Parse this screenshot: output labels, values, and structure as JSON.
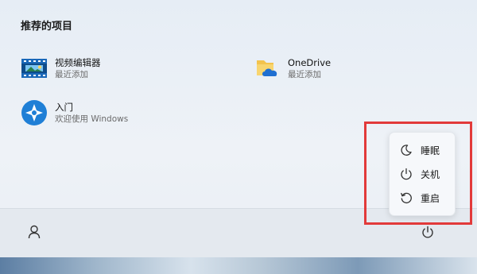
{
  "recommended": {
    "title": "推荐的项目",
    "items": [
      {
        "name": "视频编辑器",
        "subtitle": "最近添加",
        "icon": "video-editor-icon"
      },
      {
        "name": "OneDrive",
        "subtitle": "最近添加",
        "icon": "onedrive-icon"
      },
      {
        "name": "入门",
        "subtitle": "欢迎使用 Windows",
        "icon": "get-started-icon"
      }
    ]
  },
  "power_menu": {
    "items": [
      {
        "label": "睡眠",
        "icon": "sleep-icon"
      },
      {
        "label": "关机",
        "icon": "power-icon"
      },
      {
        "label": "重启",
        "icon": "restart-icon"
      }
    ]
  },
  "footer": {
    "user_icon": "user-icon",
    "power_icon": "power-icon"
  },
  "colors": {
    "highlight": "#e23a3a",
    "accent": "#1f6fd1"
  }
}
